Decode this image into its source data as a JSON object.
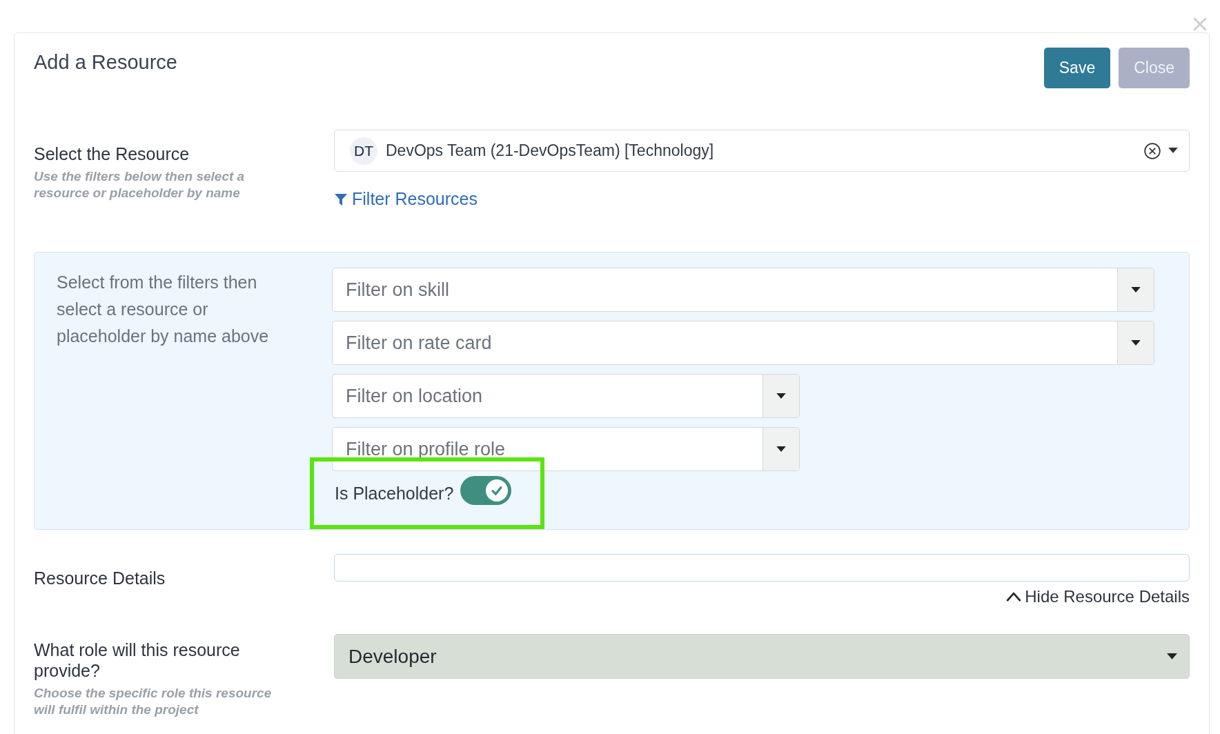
{
  "dialog": {
    "title": "Add a Resource",
    "buttons": [
      {
        "label": "Save",
        "kind": "primary",
        "disabled": false
      },
      {
        "label": "Close",
        "kind": "secondary",
        "disabled": true
      }
    ]
  },
  "resource": {
    "label": "Select the Resource",
    "hint": "Use the filters below then select a resource or placeholder by name",
    "avatar": "DT",
    "value": "DevOps Team (21-DevOpsTeam) [Technology]",
    "filter_link": "Filter Resources"
  },
  "filters": {
    "description": "Select from the filters then select a resource or placeholder by name above",
    "fields": [
      {
        "placeholder": "Filter on skill",
        "kind": "wide"
      },
      {
        "placeholder": "Filter on rate card",
        "kind": "wide"
      },
      {
        "placeholder": "Filter on location",
        "kind": "narrow"
      },
      {
        "placeholder": "Filter on profile role",
        "kind": "narrow"
      }
    ],
    "placeholder_toggle": {
      "label": "Is Placeholder?",
      "on": true,
      "highlighted": true
    }
  },
  "details": {
    "label": "Resource Details",
    "toggle_link": "Hide Resource Details",
    "expanded": true
  },
  "role": {
    "label": "What role will this resource provide?",
    "hint": "Choose the specific role this resource will fulfil within the project",
    "value": "Developer"
  }
}
